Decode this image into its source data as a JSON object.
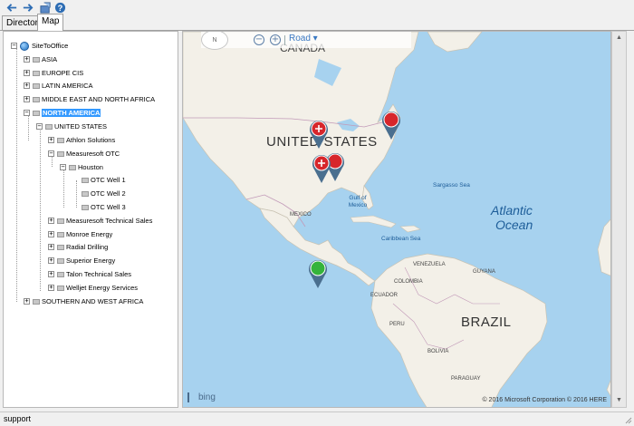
{
  "toolbar": {
    "back_icon": "back-arrow-icon",
    "forward_icon": "forward-arrow-icon",
    "export_icon": "export-icon",
    "help_icon": "help-icon"
  },
  "tabs": [
    {
      "label": "Directory",
      "active": false
    },
    {
      "label": "Map",
      "active": true
    }
  ],
  "tree": {
    "root": "SiteToOffice",
    "regions": [
      "ASIA",
      "EUROPE CIS",
      "LATIN AMERICA",
      "MIDDLE EAST AND NORTH AFRICA",
      "NORTH AMERICA",
      "SOUTHERN AND WEST AFRICA"
    ],
    "selected": "NORTH AMERICA",
    "country": "UNITED STATES",
    "companies": [
      "Athlon Solutions",
      "Measuresoft OTC",
      "Measuresoft Technical Sales",
      "Monroe Energy",
      "Radial Drilling",
      "Superior Energy",
      "Talon Technical Sales",
      "Welljet Energy Services"
    ],
    "site": "Houston",
    "wells": [
      "OTC Well 1",
      "OTC Well 2",
      "OTC Well 3"
    ]
  },
  "map": {
    "compass": "N",
    "style_label": "Road",
    "labels": {
      "canada": "CANADA",
      "usa": "UNITED STATES",
      "mexico": "MEXICO",
      "gulf": "Gulf of Mexico",
      "sargasso": "Sargasso Sea",
      "atlantic1": "Atlantic",
      "atlantic2": "Ocean",
      "caribbean": "Caribbean Sea",
      "venezuela": "VENEZUELA",
      "colombia": "COLOMBIA",
      "ecuador": "ECUADOR",
      "peru": "PERU",
      "bolivia": "BOLIVIA",
      "brazil": "BRAZIL",
      "paraguay": "PARAGUAY",
      "guyana": "GUYANA"
    },
    "copyright": "© 2016 Microsoft Corporation    © 2016 HERE",
    "brand": "bing",
    "marker_colors": {
      "red": "#d7262b",
      "green": "#35b33b",
      "shadow": "#4a6f8f"
    }
  },
  "status": {
    "text": "support"
  }
}
